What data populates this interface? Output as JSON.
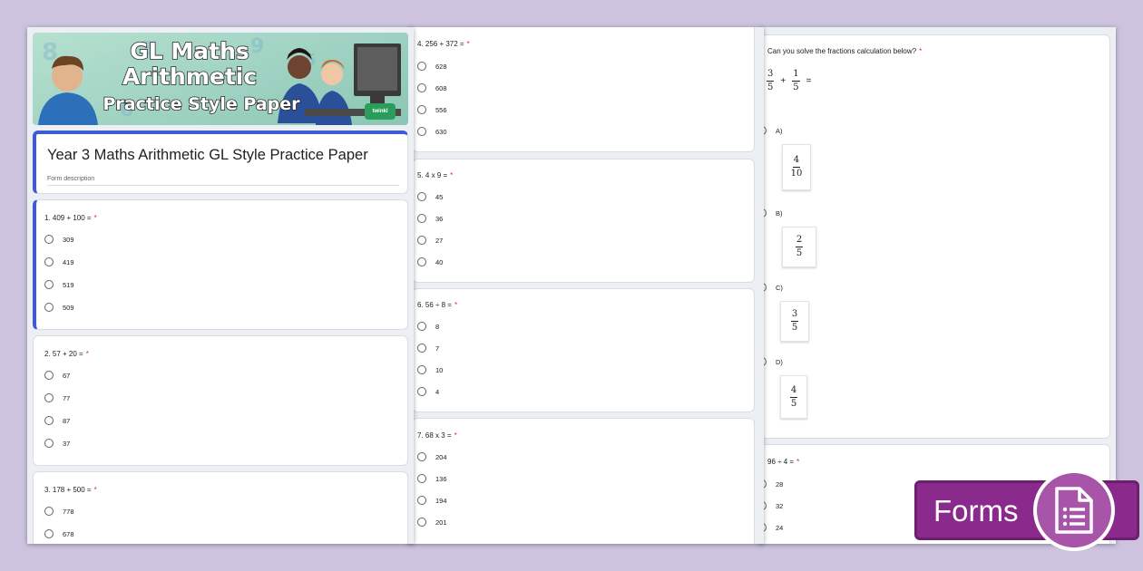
{
  "banner": {
    "line1": "GL Maths",
    "line2": "Arithmetic",
    "line3": "Practice Style Paper",
    "logo": "twinkl"
  },
  "form": {
    "title": "Year 3 Maths Arithmetic GL Style Practice Paper",
    "description": "Form description"
  },
  "required_mark": "*",
  "questions": [
    {
      "title": "1. 409 + 100 =",
      "options": [
        "309",
        "419",
        "519",
        "509"
      ]
    },
    {
      "title": "2. 57 + 20 =",
      "options": [
        "67",
        "77",
        "87",
        "37"
      ]
    },
    {
      "title": "3.  178 + 500 =",
      "options": [
        "778",
        "678"
      ]
    },
    {
      "title": "4. 256 + 372 =",
      "options": [
        "628",
        "608",
        "556",
        "630"
      ]
    },
    {
      "title": "5. 4 x 9 =",
      "options": [
        "45",
        "36",
        "27",
        "40"
      ]
    },
    {
      "title": "6.  56 ÷ 8 =",
      "options": [
        "8",
        "7",
        "10",
        "4"
      ]
    },
    {
      "title": "7. 68 x 3 =",
      "options": [
        "204",
        "136",
        "194",
        "201"
      ]
    }
  ],
  "fraction_question": {
    "title": "Can you solve the fractions calculation below?",
    "expression": {
      "a_num": "3",
      "a_den": "5",
      "op": "+",
      "b_num": "1",
      "b_den": "5",
      "eq": "="
    },
    "options": [
      {
        "letter": "A)",
        "num": "4",
        "den": "10"
      },
      {
        "letter": "B)",
        "num": "2",
        "den": "5"
      },
      {
        "letter": "C)",
        "num": "3",
        "den": "5"
      },
      {
        "letter": "D)",
        "num": "4",
        "den": "5"
      }
    ]
  },
  "partial_question": {
    "title": "96 ÷ 4 =",
    "options": [
      "28",
      "32",
      "24"
    ]
  },
  "badge": {
    "label": "Forms",
    "icon": "forms-document-icon",
    "color": "#8a2a8c"
  },
  "colors": {
    "accent": "#3e5bd3",
    "required": "#d93025",
    "background": "#cdc3df"
  }
}
